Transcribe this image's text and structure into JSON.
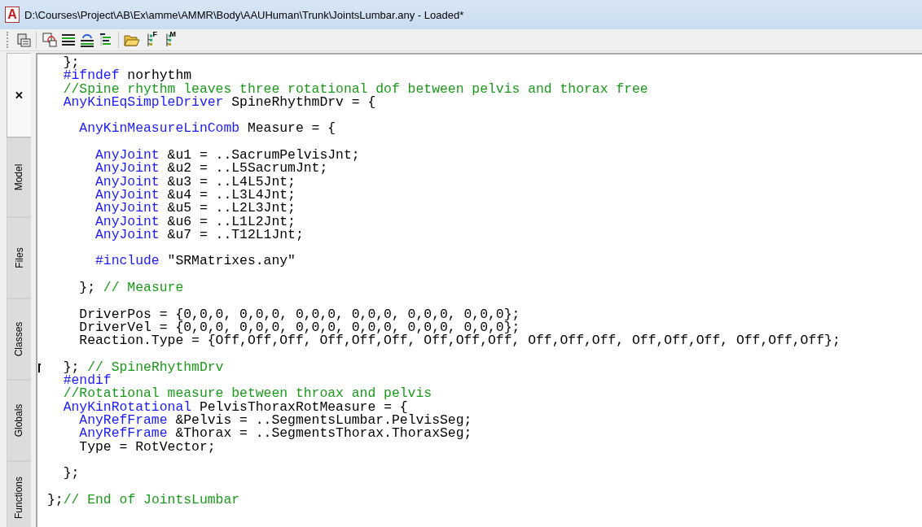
{
  "window": {
    "app_icon": "A",
    "title": "D:\\Courses\\Project\\AB\\Ex\\amme\\AMMR\\Body\\AAUHuman\\Trunk\\JointsLumbar.any - Loaded*"
  },
  "toolbar": [
    [
      {
        "kind": "clipboard"
      }
    ],
    [
      {
        "kind": "doc-red"
      },
      {
        "kind": "lines"
      },
      {
        "kind": "lines-arrow"
      },
      {
        "kind": "tree-list"
      }
    ],
    [
      {
        "kind": "folder"
      },
      {
        "kind": "tree-letter",
        "label": "F"
      },
      {
        "kind": "tree-letter",
        "label": "M"
      }
    ]
  ],
  "side_tabs": [
    {
      "label": "×",
      "selected": true
    },
    {
      "label": "Model",
      "selected": false
    },
    {
      "label": "Files",
      "selected": false
    },
    {
      "label": "Classes",
      "selected": false
    },
    {
      "label": "Globals",
      "selected": false
    },
    {
      "label": "Functions",
      "selected": false
    }
  ],
  "code_lines": [
    {
      "kind": "code",
      "marker": false,
      "segments": [
        {
          "kind": "plain",
          "text": "  };"
        }
      ]
    },
    {
      "kind": "code",
      "marker": false,
      "segments": [
        {
          "kind": "keyword",
          "text": "  #ifndef"
        },
        {
          "kind": "plain",
          "text": " norhythm"
        }
      ]
    },
    {
      "kind": "code",
      "marker": false,
      "segments": [
        {
          "kind": "comment",
          "text": "  //Spine rhythm leaves three rotational dof between pelvis and thorax free"
        }
      ]
    },
    {
      "kind": "code",
      "marker": false,
      "segments": [
        {
          "kind": "keyword",
          "text": "  AnyKinEqSimpleDriver"
        },
        {
          "kind": "plain",
          "text": " SpineRhythmDrv = {"
        }
      ]
    },
    {
      "kind": "blank"
    },
    {
      "kind": "code",
      "marker": false,
      "segments": [
        {
          "kind": "keyword",
          "text": "    AnyKinMeasureLinComb"
        },
        {
          "kind": "plain",
          "text": " Measure = {"
        }
      ]
    },
    {
      "kind": "blank"
    },
    {
      "kind": "code",
      "marker": false,
      "segments": [
        {
          "kind": "keyword",
          "text": "      AnyJoint"
        },
        {
          "kind": "plain",
          "text": " &u1 = ..SacrumPelvisJnt;"
        }
      ]
    },
    {
      "kind": "code",
      "marker": false,
      "segments": [
        {
          "kind": "keyword",
          "text": "      AnyJoint"
        },
        {
          "kind": "plain",
          "text": " &u2 = ..L5SacrumJnt;"
        }
      ]
    },
    {
      "kind": "code",
      "marker": false,
      "segments": [
        {
          "kind": "keyword",
          "text": "      AnyJoint"
        },
        {
          "kind": "plain",
          "text": " &u3 = ..L4L5Jnt;"
        }
      ]
    },
    {
      "kind": "code",
      "marker": false,
      "segments": [
        {
          "kind": "keyword",
          "text": "      AnyJoint"
        },
        {
          "kind": "plain",
          "text": " &u4 = ..L3L4Jnt;"
        }
      ]
    },
    {
      "kind": "code",
      "marker": false,
      "segments": [
        {
          "kind": "keyword",
          "text": "      AnyJoint"
        },
        {
          "kind": "plain",
          "text": " &u5 = ..L2L3Jnt;"
        }
      ]
    },
    {
      "kind": "code",
      "marker": false,
      "segments": [
        {
          "kind": "keyword",
          "text": "      AnyJoint"
        },
        {
          "kind": "plain",
          "text": " &u6 = ..L1L2Jnt;"
        }
      ]
    },
    {
      "kind": "code",
      "marker": false,
      "segments": [
        {
          "kind": "keyword",
          "text": "      AnyJoint"
        },
        {
          "kind": "plain",
          "text": " &u7 = ..T12L1Jnt;"
        }
      ]
    },
    {
      "kind": "blank"
    },
    {
      "kind": "code",
      "marker": false,
      "segments": [
        {
          "kind": "keyword",
          "text": "      #include"
        },
        {
          "kind": "plain",
          "text": " \"SRMatrixes.any\""
        }
      ]
    },
    {
      "kind": "blank"
    },
    {
      "kind": "code",
      "marker": false,
      "segments": [
        {
          "kind": "plain",
          "text": "    }; "
        },
        {
          "kind": "comment",
          "text": "// Measure"
        }
      ]
    },
    {
      "kind": "blank"
    },
    {
      "kind": "code",
      "marker": false,
      "segments": [
        {
          "kind": "plain",
          "text": "    DriverPos = {0,0,0, 0,0,0, 0,0,0, 0,0,0, 0,0,0, 0,0,0};"
        }
      ]
    },
    {
      "kind": "code",
      "marker": false,
      "segments": [
        {
          "kind": "plain",
          "text": "    DriverVel = {0,0,0, 0,0,0, 0,0,0, 0,0,0, 0,0,0, 0,0,0};"
        }
      ]
    },
    {
      "kind": "code",
      "marker": false,
      "segments": [
        {
          "kind": "plain",
          "text": "    Reaction.Type = {Off,Off,Off, Off,Off,Off, Off,Off,Off, Off,Off,Off, Off,Off,Off, Off,Off,Off};"
        }
      ]
    },
    {
      "kind": "blank"
    },
    {
      "kind": "code",
      "marker": true,
      "segments": [
        {
          "kind": "plain",
          "text": "  }; "
        },
        {
          "kind": "comment",
          "text": "// SpineRhythmDrv"
        }
      ]
    },
    {
      "kind": "code",
      "marker": false,
      "segments": [
        {
          "kind": "keyword",
          "text": "  #endif"
        }
      ]
    },
    {
      "kind": "code",
      "marker": false,
      "segments": [
        {
          "kind": "comment",
          "text": "  //Rotational measure between throax and pelvis"
        }
      ]
    },
    {
      "kind": "code",
      "marker": false,
      "segments": [
        {
          "kind": "keyword",
          "text": "  AnyKinRotational"
        },
        {
          "kind": "plain",
          "text": " PelvisThoraxRotMeasure = {"
        }
      ]
    },
    {
      "kind": "code",
      "marker": false,
      "segments": [
        {
          "kind": "keyword",
          "text": "    AnyRefFrame"
        },
        {
          "kind": "plain",
          "text": " &Pelvis = ..SegmentsLumbar.PelvisSeg;"
        }
      ]
    },
    {
      "kind": "code",
      "marker": false,
      "segments": [
        {
          "kind": "keyword",
          "text": "    AnyRefFrame"
        },
        {
          "kind": "plain",
          "text": " &Thorax = ..SegmentsThorax.ThoraxSeg;"
        }
      ]
    },
    {
      "kind": "code",
      "marker": false,
      "segments": [
        {
          "kind": "plain",
          "text": "    Type = RotVector;"
        }
      ]
    },
    {
      "kind": "blank"
    },
    {
      "kind": "code",
      "marker": false,
      "segments": [
        {
          "kind": "plain",
          "text": "  };"
        }
      ]
    },
    {
      "kind": "blank"
    },
    {
      "kind": "code",
      "marker": false,
      "segments": [
        {
          "kind": "plain",
          "text": "};"
        },
        {
          "kind": "comment",
          "text": "// End of JointsLumbar"
        }
      ]
    }
  ]
}
